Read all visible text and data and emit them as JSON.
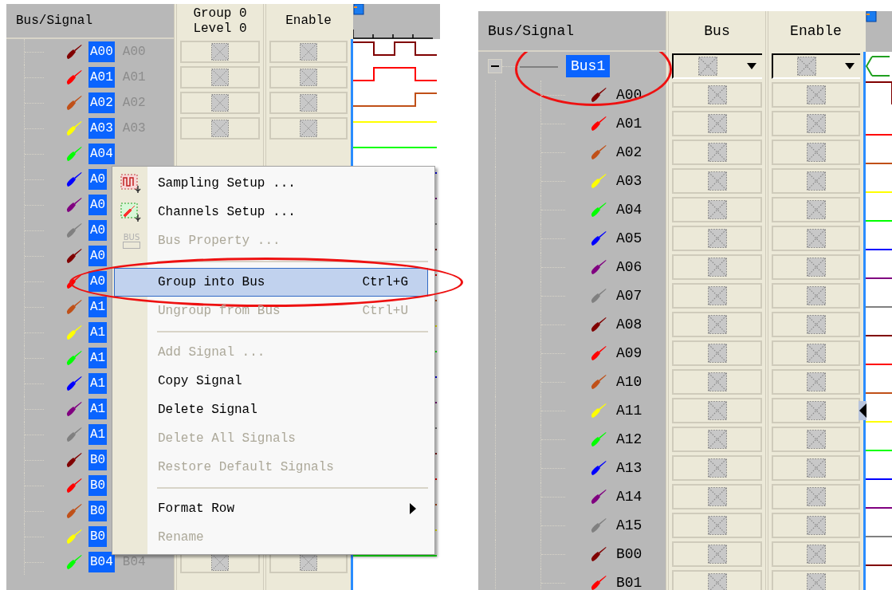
{
  "left_view": {
    "columns": [
      {
        "label": "Bus/Signal"
      },
      {
        "label": "Group 0\nLevel 0"
      },
      {
        "label": "Enable"
      }
    ],
    "rows": [
      {
        "name": "A00",
        "alias": "A00",
        "color": "#800000",
        "kind": "visible",
        "selected": true
      },
      {
        "name": "A01",
        "alias": "A01",
        "color": "#ff0000",
        "kind": "visible",
        "selected": true
      },
      {
        "name": "A02",
        "alias": "A02",
        "color": "#c05018",
        "kind": "visible",
        "selected": true
      },
      {
        "name": "A03",
        "alias": "A03",
        "color": "#ffff00",
        "kind": "visible",
        "selected": true
      },
      {
        "name": "A04",
        "color": "#00ff00",
        "kind": "covered",
        "selected": true
      },
      {
        "name": "A0",
        "color": "#0000ff",
        "kind": "covered",
        "selected": true
      },
      {
        "name": "A0",
        "color": "#800080",
        "kind": "covered",
        "selected": true
      },
      {
        "name": "A0",
        "color": "#808080",
        "kind": "covered",
        "selected": true
      },
      {
        "name": "A0",
        "color": "#800000",
        "kind": "covered",
        "selected": true
      },
      {
        "name": "A0",
        "color": "#ff0000",
        "kind": "covered",
        "selected": true
      },
      {
        "name": "A1",
        "color": "#c05018",
        "kind": "covered",
        "selected": true
      },
      {
        "name": "A1",
        "color": "#ffff00",
        "kind": "covered",
        "selected": true
      },
      {
        "name": "A1",
        "color": "#00ff00",
        "kind": "covered",
        "selected": true
      },
      {
        "name": "A1",
        "color": "#0000ff",
        "kind": "covered",
        "selected": true
      },
      {
        "name": "A1",
        "color": "#800080",
        "kind": "covered",
        "selected": true
      },
      {
        "name": "A1",
        "color": "#808080",
        "kind": "covered",
        "selected": true
      },
      {
        "name": "B0",
        "color": "#800000",
        "kind": "covered",
        "selected": true
      },
      {
        "name": "B0",
        "color": "#ff0000",
        "kind": "covered",
        "selected": true
      },
      {
        "name": "B0",
        "color": "#c05018",
        "kind": "covered",
        "selected": true
      },
      {
        "name": "B0",
        "color": "#ffff00",
        "kind": "covered",
        "selected": true
      },
      {
        "name": "B04",
        "alias": "B04",
        "color": "#00ff00",
        "kind": "visible",
        "selected": true
      }
    ],
    "context_menu": [
      {
        "kind": "sampling-item",
        "label": "Sampling Setup ...",
        "submenu": false,
        "disabled": false,
        "selected": false,
        "circled": false
      },
      {
        "kind": "channels-item",
        "label": "Channels Setup ...",
        "submenu": false,
        "disabled": false,
        "selected": false,
        "circled": false
      },
      {
        "kind": "bus-item",
        "label": "Bus Property ...",
        "icon_label": "BUS",
        "submenu": false,
        "disabled": true,
        "selected": false,
        "circled": false
      },
      {
        "kind": "separator"
      },
      {
        "kind": "item",
        "label": "Group into Bus",
        "shortcut": "Ctrl+G",
        "submenu": false,
        "disabled": false,
        "selected": true,
        "circled": true
      },
      {
        "kind": "item",
        "label": "Ungroup from Bus",
        "shortcut": "Ctrl+U",
        "submenu": false,
        "disabled": true,
        "selected": false,
        "circled": false
      },
      {
        "kind": "separator"
      },
      {
        "kind": "item",
        "label": "Add Signal ...",
        "submenu": false,
        "disabled": true,
        "selected": false,
        "circled": false
      },
      {
        "kind": "item",
        "label": "Copy Signal",
        "submenu": false,
        "disabled": false,
        "selected": false,
        "circled": false
      },
      {
        "kind": "item",
        "label": "Delete Signal",
        "submenu": false,
        "disabled": false,
        "selected": false,
        "circled": false
      },
      {
        "kind": "item",
        "label": "Delete All Signals",
        "submenu": false,
        "disabled": true,
        "selected": false,
        "circled": false
      },
      {
        "kind": "item",
        "label": "Restore Default Signals",
        "submenu": false,
        "disabled": true,
        "selected": false,
        "circled": false
      },
      {
        "kind": "separator"
      },
      {
        "kind": "item",
        "label": "Format Row",
        "submenu": true,
        "disabled": false,
        "selected": false,
        "circled": false
      },
      {
        "kind": "item",
        "label": "Rename",
        "submenu": false,
        "disabled": true,
        "selected": false,
        "circled": false
      }
    ]
  },
  "right_view": {
    "columns": [
      {
        "label": "Bus/Signal"
      },
      {
        "label": "Bus"
      },
      {
        "label": "Enable"
      }
    ],
    "bus": {
      "name": "Bus1",
      "expanded": true,
      "selected": true,
      "circled": true,
      "children": [
        {
          "name": "A00",
          "color": "#800000",
          "selected": false,
          "current": false
        },
        {
          "name": "A01",
          "color": "#ff0000",
          "selected": false,
          "current": false
        },
        {
          "name": "A02",
          "color": "#c05018",
          "selected": false,
          "current": false
        },
        {
          "name": "A03",
          "color": "#ffff00",
          "selected": false,
          "current": false
        },
        {
          "name": "A04",
          "color": "#00ff00",
          "selected": false,
          "current": false
        },
        {
          "name": "A05",
          "color": "#0000ff",
          "selected": false,
          "current": false
        },
        {
          "name": "A06",
          "color": "#800080",
          "selected": false,
          "current": false
        },
        {
          "name": "A07",
          "color": "#808080",
          "selected": false,
          "current": false
        },
        {
          "name": "A08",
          "color": "#800000",
          "selected": false,
          "current": false
        },
        {
          "name": "A09",
          "color": "#ff0000",
          "selected": false,
          "current": false
        },
        {
          "name": "A10",
          "color": "#c05018",
          "selected": false,
          "current": false
        },
        {
          "name": "A11",
          "color": "#ffff00",
          "selected": false,
          "current": true
        },
        {
          "name": "A12",
          "color": "#00ff00",
          "selected": false,
          "current": false
        },
        {
          "name": "A13",
          "color": "#0000ff",
          "selected": false,
          "current": false
        },
        {
          "name": "A14",
          "color": "#800080",
          "selected": false,
          "current": false
        },
        {
          "name": "A15",
          "color": "#808080",
          "selected": false,
          "current": false
        },
        {
          "name": "B00",
          "color": "#800000",
          "selected": false,
          "current": false
        },
        {
          "name": "B01",
          "color": "#ff0000",
          "selected": false,
          "current": false
        }
      ]
    }
  }
}
